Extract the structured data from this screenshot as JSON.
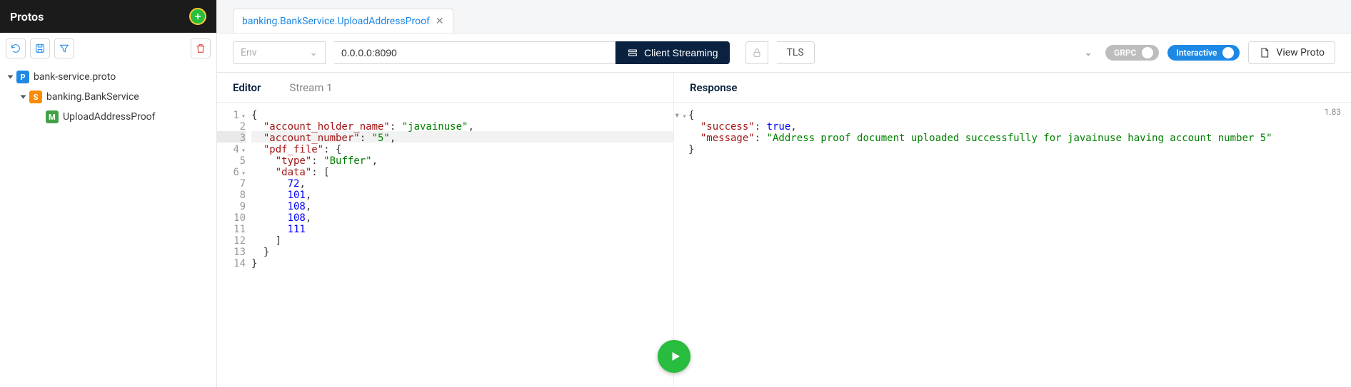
{
  "sidebar": {
    "title": "Protos",
    "tree": {
      "proto_file": "bank-service.proto",
      "service": "banking.BankService",
      "method": "UploadAddressProof"
    }
  },
  "tabs": [
    {
      "label": "banking.BankService.UploadAddressProof"
    }
  ],
  "action_bar": {
    "env_placeholder": "Env",
    "address": "0.0.0.0:8090",
    "method_button": "Client Streaming",
    "tls_label": "TLS",
    "grpc_pill": "GRPC",
    "interactive_pill": "Interactive",
    "view_proto": "View Proto"
  },
  "editor": {
    "tabs": {
      "editor": "Editor",
      "stream": "Stream 1"
    },
    "highlight_line": 3,
    "lines": [
      {
        "n": 1,
        "fold": true,
        "tokens": [
          {
            "t": "plain",
            "v": "{"
          }
        ]
      },
      {
        "n": 2,
        "fold": false,
        "tokens": [
          {
            "t": "plain",
            "v": "  "
          },
          {
            "t": "key",
            "v": "\"account_holder_name\""
          },
          {
            "t": "plain",
            "v": ": "
          },
          {
            "t": "str",
            "v": "\"javainuse\""
          },
          {
            "t": "plain",
            "v": ","
          }
        ]
      },
      {
        "n": 3,
        "fold": false,
        "tokens": [
          {
            "t": "plain",
            "v": "  "
          },
          {
            "t": "key",
            "v": "\"account_number\""
          },
          {
            "t": "plain",
            "v": ": "
          },
          {
            "t": "str",
            "v": "\"5\""
          },
          {
            "t": "plain",
            "v": ","
          }
        ]
      },
      {
        "n": 4,
        "fold": true,
        "tokens": [
          {
            "t": "plain",
            "v": "  "
          },
          {
            "t": "key",
            "v": "\"pdf_file\""
          },
          {
            "t": "plain",
            "v": ": {"
          }
        ]
      },
      {
        "n": 5,
        "fold": false,
        "tokens": [
          {
            "t": "plain",
            "v": "    "
          },
          {
            "t": "key",
            "v": "\"type\""
          },
          {
            "t": "plain",
            "v": ": "
          },
          {
            "t": "str",
            "v": "\"Buffer\""
          },
          {
            "t": "plain",
            "v": ","
          }
        ]
      },
      {
        "n": 6,
        "fold": true,
        "tokens": [
          {
            "t": "plain",
            "v": "    "
          },
          {
            "t": "key",
            "v": "\"data\""
          },
          {
            "t": "plain",
            "v": ": ["
          }
        ]
      },
      {
        "n": 7,
        "fold": false,
        "tokens": [
          {
            "t": "plain",
            "v": "      "
          },
          {
            "t": "num",
            "v": "72"
          },
          {
            "t": "plain",
            "v": ","
          }
        ]
      },
      {
        "n": 8,
        "fold": false,
        "tokens": [
          {
            "t": "plain",
            "v": "      "
          },
          {
            "t": "num",
            "v": "101"
          },
          {
            "t": "plain",
            "v": ","
          }
        ]
      },
      {
        "n": 9,
        "fold": false,
        "tokens": [
          {
            "t": "plain",
            "v": "      "
          },
          {
            "t": "num",
            "v": "108"
          },
          {
            "t": "plain",
            "v": ","
          }
        ]
      },
      {
        "n": 10,
        "fold": false,
        "tokens": [
          {
            "t": "plain",
            "v": "      "
          },
          {
            "t": "num",
            "v": "108"
          },
          {
            "t": "plain",
            "v": ","
          }
        ]
      },
      {
        "n": 11,
        "fold": false,
        "tokens": [
          {
            "t": "plain",
            "v": "      "
          },
          {
            "t": "num",
            "v": "111"
          }
        ]
      },
      {
        "n": 12,
        "fold": false,
        "tokens": [
          {
            "t": "plain",
            "v": "    ]"
          }
        ]
      },
      {
        "n": 13,
        "fold": false,
        "tokens": [
          {
            "t": "plain",
            "v": "  }"
          }
        ]
      },
      {
        "n": 14,
        "fold": false,
        "tokens": [
          {
            "t": "plain",
            "v": "}"
          }
        ]
      }
    ]
  },
  "response": {
    "title": "Response",
    "timing": "1.83",
    "lines": [
      {
        "fold": true,
        "tokens": [
          {
            "t": "plain",
            "v": "{"
          }
        ]
      },
      {
        "fold": false,
        "tokens": [
          {
            "t": "plain",
            "v": "  "
          },
          {
            "t": "key",
            "v": "\"success\""
          },
          {
            "t": "plain",
            "v": ": "
          },
          {
            "t": "bool",
            "v": "true"
          },
          {
            "t": "plain",
            "v": ","
          }
        ]
      },
      {
        "fold": false,
        "tokens": [
          {
            "t": "plain",
            "v": "  "
          },
          {
            "t": "key",
            "v": "\"message\""
          },
          {
            "t": "plain",
            "v": ": "
          },
          {
            "t": "str",
            "v": "\"Address proof document uploaded successfully for javainuse having account number 5\""
          }
        ]
      },
      {
        "fold": false,
        "tokens": [
          {
            "t": "plain",
            "v": "}"
          }
        ]
      }
    ]
  }
}
